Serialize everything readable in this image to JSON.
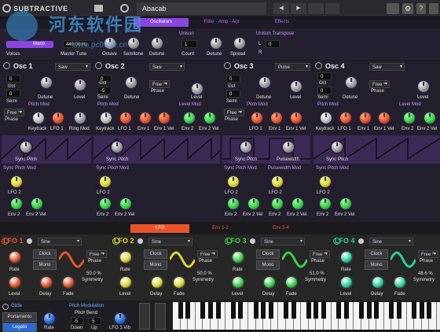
{
  "toolbar": {
    "app_name": "SUBTRACTIVE",
    "preset": "Abacab"
  },
  "main_tabs": [
    "Oscillators",
    "Filter - Amp - Arp",
    "Effects"
  ],
  "global": {
    "poly_label": "Mono",
    "tune_value": "440.00 Hz",
    "voices": "Voices",
    "master_tune": "Master Tune",
    "octave": "Octave",
    "semitone": "Semitone",
    "detune": "Detune",
    "unison": "Unison",
    "count_value": "1",
    "count": "Count",
    "unison_detune": "Detune",
    "spread": "Spread",
    "unison_transpose": "Unison Transpose",
    "transpose_l": "L",
    "transpose_l_val": "0",
    "transpose_r": "R"
  },
  "osc": [
    {
      "name": "Osc 1",
      "wave": "Saw",
      "oct": "0",
      "semi": "0",
      "free": "Free *",
      "phase": "Phase"
    },
    {
      "name": "Osc 2",
      "wave": "Saw",
      "oct": "0",
      "semi": "-5",
      "free": "Free *",
      "phase": "Phase"
    },
    {
      "name": "Osc 3",
      "wave": "Pulse",
      "oct": "0",
      "semi": "0",
      "free": "Free *",
      "phase": "Phase"
    },
    {
      "name": "Osc 4",
      "wave": "Saw",
      "oct": "0",
      "semi": "0",
      "free": "Free *",
      "phase": "Phase"
    }
  ],
  "osc_labels": {
    "oct": "Oct",
    "semi": "Semi",
    "detune": "Detune",
    "level": "Level",
    "pitch_mod": "Pitch Mod",
    "level_mod": "Level Mod",
    "keytrack": "Keytrack",
    "lfo1": "LFO 1",
    "ring_mod": "Ring Mod",
    "env1": "Env 1",
    "env1_vel": "Env 1 Vel",
    "env2": "Env 2",
    "env2_vel": "Env 2 Vel",
    "sync_pitch": "Sync Pitch",
    "pulsewidth": "Pulsewidth",
    "sync_pitch_mod": "Sync Pitch Mod",
    "pw_mod": "Pulsewidth Mod",
    "lfo2": "LFO 2"
  },
  "mod_tabs": [
    "LFO",
    "Env 1-2",
    "Env 3-4"
  ],
  "lfo": [
    {
      "name": "LFO 1",
      "wave": "Sine",
      "clock": "Clock",
      "mono": "Mono",
      "free": "Free *",
      "phase": "Phase",
      "sym": "50.0 %",
      "color": "#e8542a"
    },
    {
      "name": "LFO 2",
      "wave": "Sine",
      "clock": "Clock",
      "mono": "Mono",
      "free": "Free *",
      "phase": "Phase",
      "sym": "50.0 %",
      "color": "#d8d83a"
    },
    {
      "name": "LFO 3",
      "wave": "Sine",
      "clock": "Clock",
      "mono": "Mono",
      "free": "Free *",
      "phase": "Phase",
      "sym": "51.0 %",
      "color": "#3ad24a"
    },
    {
      "name": "LFO 4",
      "wave": "Sine",
      "clock": "Clock",
      "mono": "Mono",
      "free": "Free *",
      "phase": "Phase",
      "sym": "48.6 %",
      "color": "#2ad2a0"
    }
  ],
  "lfo_labels": {
    "rate": "Rate",
    "level": "Level",
    "delay": "Delay",
    "fade": "Fade",
    "symmetry": "Symmetry"
  },
  "bottom": {
    "glide": "Glide",
    "portamento": "Portamento",
    "legato": "Legato",
    "rate": "Rate",
    "pitch_modulation": "Pitch Modulation",
    "pitch_bend": "Pitch Bend",
    "down": "Down",
    "down_val": "-5",
    "up": "Up",
    "up_val": "5",
    "lfo1_vib": "LFO 1 Vib"
  },
  "watermark": {
    "title": "河东软件园",
    "url": "www.pc0359.cn"
  }
}
